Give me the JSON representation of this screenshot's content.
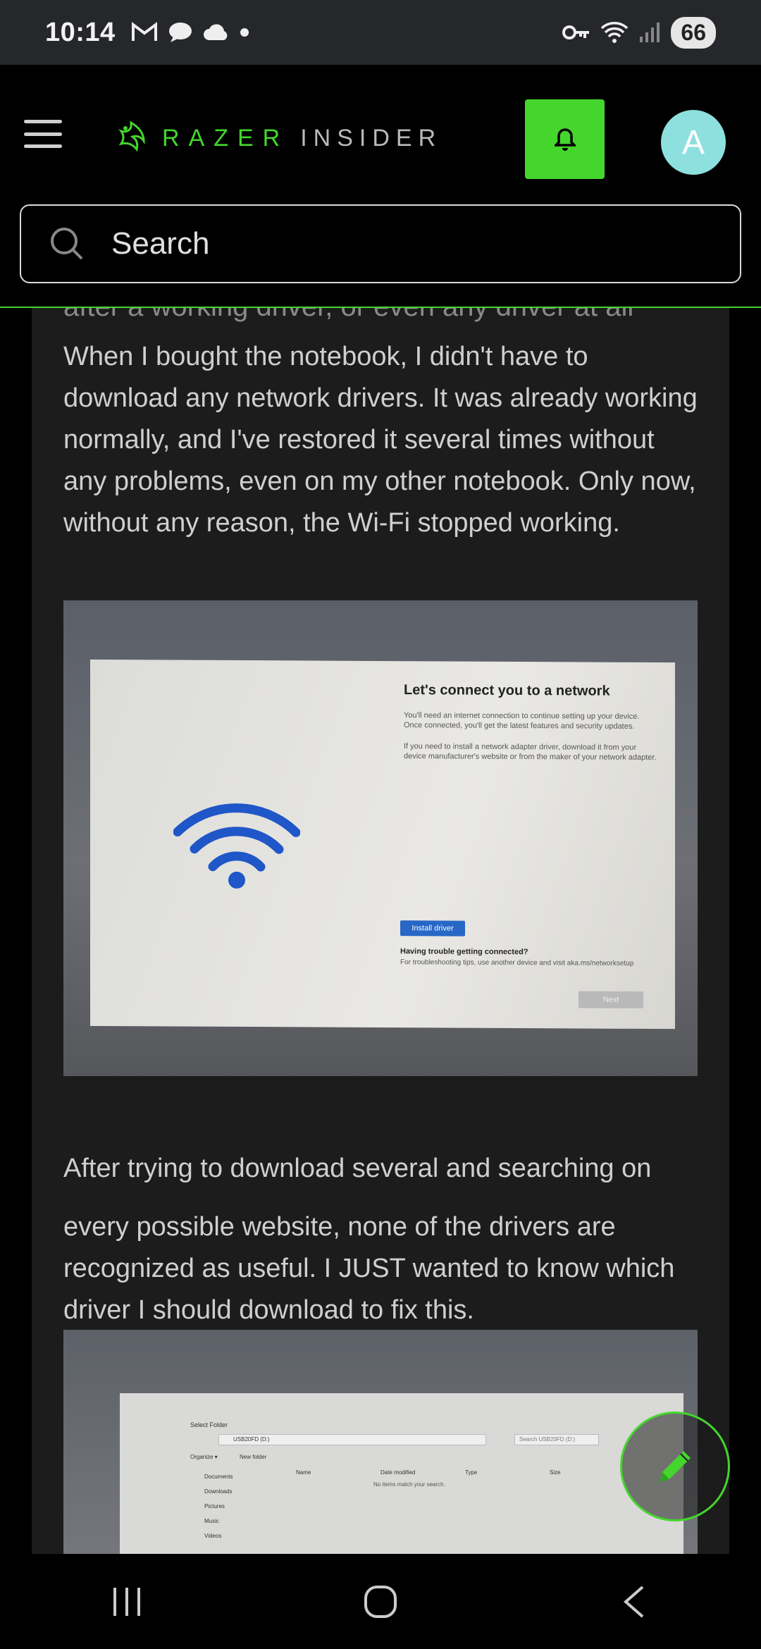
{
  "status_bar": {
    "time": "10:14",
    "battery": "66"
  },
  "header": {
    "brand": "RAZER",
    "brand_suffix": "INSIDER",
    "avatar_letter": "A",
    "search_placeholder": "Search"
  },
  "post": {
    "cut_line": "after a working driver, or even any driver at all",
    "paragraph1": "When I bought the notebook, I didn't have to download any network drivers. It was already working normally, and I've restored it several times without any problems, even on my other notebook. Only now, without any reason, the Wi-Fi stopped working.",
    "paragraph2": "After trying to download several and searching on",
    "paragraph3": "every possible website, none of the drivers are recognized as useful. I JUST wanted to know which driver I should download to fix this.",
    "image1": {
      "title": "Let's connect you to a network",
      "text1": "You'll need an internet connection to continue setting up your device. Once connected, you'll get the latest features and security updates.",
      "text2": "If you need to install a network adapter driver, download it from your device manufacturer's website or from the maker of your network adapter.",
      "install_button": "Install driver",
      "trouble_heading": "Having trouble getting connected?",
      "trouble_text": "For troubleshooting tips, use another device and visit aka.ms/networksetup",
      "next_button": "Next"
    },
    "image2": {
      "dialog_title": "Select Folder",
      "address": "USB20FD (D:)",
      "search": "Search USB20FD (D:)",
      "organize": "Organize ▾",
      "new_folder": "New folder",
      "nav_items": [
        "Documents",
        "Downloads",
        "Pictures",
        "Music",
        "Videos"
      ],
      "columns": [
        "Name",
        "Date modified",
        "Type",
        "Size"
      ],
      "empty": "No items match your search."
    }
  },
  "colors": {
    "accent": "#44d62c",
    "avatar": "#8ee0df",
    "card": "#1c1c1c"
  }
}
